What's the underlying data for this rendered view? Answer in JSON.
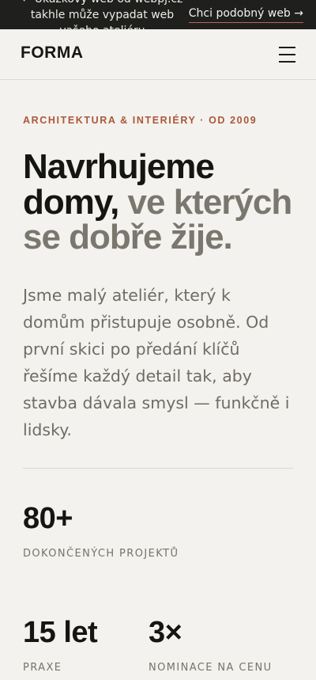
{
  "topbar": {
    "promo": "← Ukázkový web od webpj.cz takhle může vypadat web vašeho ateliéru",
    "cta_label": "Chci podobný web →"
  },
  "header": {
    "logo": "FORMA",
    "menu_icon": "hamburger-menu-icon"
  },
  "hero": {
    "eyebrow": "ARCHITEKTURA & INTERIÉRY · OD 2009",
    "headline_strong": "Navrhujeme domy,",
    "headline_muted": "ve kterých se dobře žije.",
    "lede": "Jsme malý ateliér, který k domům přistupuje osobně. Od první skici po předání klíčů řešíme každý detail tak, aby stavba dávala smysl — funkčně i lidsky."
  },
  "stats": [
    {
      "value": "80+",
      "label": "DOKONČENÝCH PROJEKTŮ"
    },
    {
      "value": "15 let",
      "label": "PRAXE"
    },
    {
      "value": "3×",
      "label": "NOMINACE NA CENU"
    }
  ],
  "colors": {
    "background": "#f4f2ee",
    "topbar": "#1f1f1d",
    "accent": "#a9583c",
    "muted_text": "#7a776f"
  }
}
